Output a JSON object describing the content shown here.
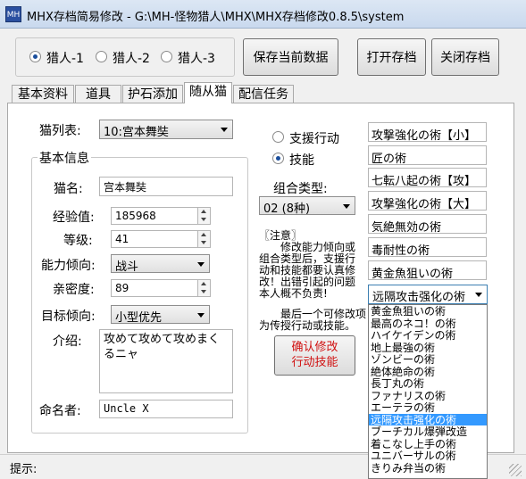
{
  "window": {
    "title": "MHX存档简易修改 - G:\\MH-怪物猎人\\MHX\\MHX存档修改0.8.5\\system",
    "icon": "app-icon"
  },
  "hunters": [
    {
      "label": "猎人-1",
      "selected": true
    },
    {
      "label": "猎人-2",
      "selected": false
    },
    {
      "label": "猎人-3",
      "selected": false
    }
  ],
  "buttons": {
    "save_current": "保存当前数据",
    "open_save": "打开存档",
    "close_save": "关闭存档"
  },
  "tabs": [
    {
      "label": "基本资料",
      "active": false
    },
    {
      "label": "道具",
      "active": false
    },
    {
      "label": "护石添加",
      "active": false
    },
    {
      "label": "随从猫",
      "active": true
    },
    {
      "label": "配信任务",
      "active": false
    }
  ],
  "cat": {
    "list_label": "猫列表:",
    "list_value": "10:宫本舞奘",
    "basic_info": "基本信息",
    "name_label": "猫名:",
    "name_value": "宫本舞奘",
    "exp_label": "经验值:",
    "exp_value": "185968",
    "level_label": "等级:",
    "level_value": "41",
    "ability_label": "能力倾向:",
    "ability_value": "战斗",
    "affinity_label": "亲密度:",
    "affinity_value": "89",
    "target_label": "目标倾向:",
    "target_value": "小型优先",
    "intro_label": "介绍:",
    "intro_value": "攻めて攻めて攻めまくるニャ",
    "namer_label": "命名者:",
    "namer_value": "Uncle X"
  },
  "mode": {
    "support_label": "支援行动",
    "support_selected": false,
    "skill_label": "技能",
    "skill_selected": true,
    "combo_type_label": "组合类型:",
    "combo_type_value": "02 (8种)"
  },
  "notice": {
    "line1": "〖注意〗",
    "line2": "修改能力倾向或",
    "line3": "组合类型后，支援行",
    "line4": "动和技能都要认真修",
    "line5": "改！出错引起的问题",
    "line6": "本人概不负责!",
    "line7": "最后一个可修改项",
    "line8": "为传授行动或技能。"
  },
  "confirm_button": {
    "line1": "确认修改",
    "line2": "行动技能"
  },
  "skills": [
    "攻撃強化の術【小】",
    "匠の術",
    "七転八起の術【攻】",
    "攻撃強化の術【大】",
    "気絶無効の術",
    "毒耐性の術",
    "黄金魚狙いの術"
  ],
  "skill_select_value": "远隔攻击强化の術",
  "dropdown_options": [
    "黄金魚狙いの術",
    "最高のネコ！の術",
    "ハイケイデンの術",
    "地上最強の術",
    "ゾンビーの術",
    "絶体絶命の術",
    "長丁丸の術",
    "ファナリスの術",
    "エーテラの術",
    "远隔攻击强化の術",
    "ブーチカル爆弾改造",
    "着こなし上手の術",
    "ユニバーサルの術",
    "きりみ弁当の術"
  ],
  "dropdown_highlight_index": 9,
  "status": {
    "label": "提示:"
  }
}
